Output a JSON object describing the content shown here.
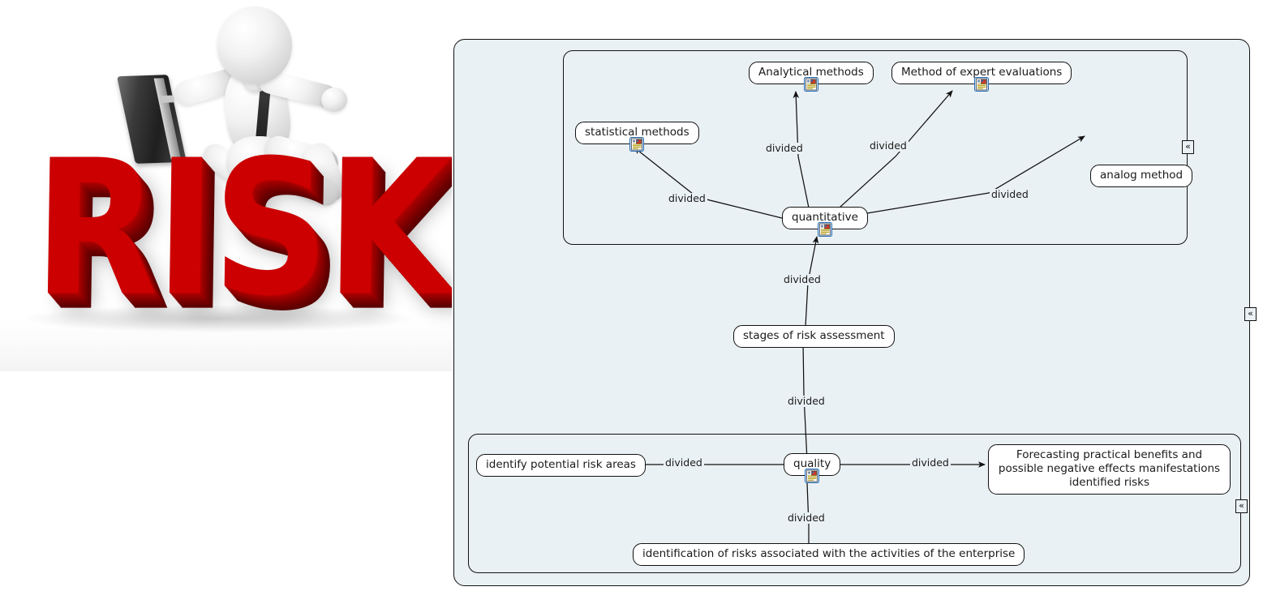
{
  "illustration": {
    "alt_name": "risk-3d-illustration",
    "word": "RISK",
    "word_color": "#cc0000",
    "figure_name": "running-businessman-figure",
    "briefcase_name": "briefcase"
  },
  "diagram": {
    "background_color": "#eaf1f4",
    "node_fill": "#ffffff",
    "line_color": "#111111",
    "collapse_glyph": "«",
    "groups": [
      {
        "id": "group-quantitative",
        "label": ""
      },
      {
        "id": "group-quality",
        "label": ""
      }
    ],
    "nodes": [
      {
        "id": "analytical-methods",
        "label": "Analytical methods",
        "has_icon": true
      },
      {
        "id": "expert-evaluations",
        "label": "Method of expert evaluations",
        "has_icon": true
      },
      {
        "id": "statistical-methods",
        "label": "statistical methods",
        "has_icon": true
      },
      {
        "id": "analog-method",
        "label": "analog method",
        "has_icon": false
      },
      {
        "id": "quantitative",
        "label": "quantitative",
        "has_icon": true
      },
      {
        "id": "stages-of-risk",
        "label": "stages of risk assessment",
        "has_icon": false
      },
      {
        "id": "quality",
        "label": "quality",
        "has_icon": true
      },
      {
        "id": "identify-areas",
        "label": "identify potential risk areas",
        "has_icon": false
      },
      {
        "id": "forecasting",
        "label": "Forecasting practical benefits and possible negative effects manifestations identified risks",
        "has_icon": false
      },
      {
        "id": "identification",
        "label": "identification of risks associated with the activities of the enterprise",
        "has_icon": false
      }
    ],
    "edge_labels": [
      {
        "id": "e1",
        "label": "divided"
      },
      {
        "id": "e2",
        "label": "divided"
      },
      {
        "id": "e3",
        "label": "divided"
      },
      {
        "id": "e4",
        "label": "divided"
      },
      {
        "id": "e5",
        "label": "divided"
      },
      {
        "id": "e6",
        "label": "divided"
      },
      {
        "id": "e7",
        "label": "divided"
      },
      {
        "id": "e8",
        "label": "divided"
      },
      {
        "id": "e9",
        "label": "divided"
      }
    ],
    "collapse_handles": [
      {
        "id": "handle-quantitative-group",
        "glyph": "«"
      },
      {
        "id": "handle-outer",
        "glyph": "«"
      },
      {
        "id": "handle-quality-group",
        "glyph": "«"
      }
    ]
  }
}
